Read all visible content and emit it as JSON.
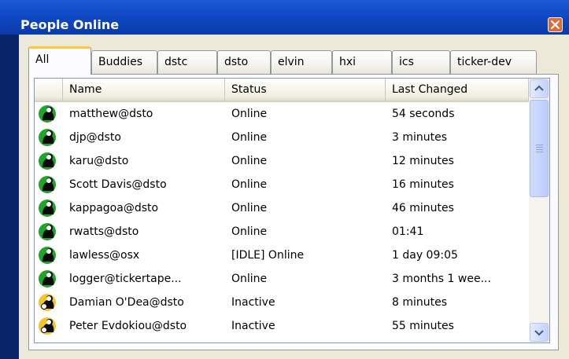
{
  "window": {
    "title": "People Online",
    "colors": {
      "titlebar": "#0e46c0",
      "close": "#e4663a",
      "active_tab_accent": "#ffc83c"
    }
  },
  "tabs": [
    {
      "label": "All",
      "active": true
    },
    {
      "label": "Buddies",
      "active": false
    },
    {
      "label": "dstc",
      "active": false
    },
    {
      "label": "dsto",
      "active": false
    },
    {
      "label": "elvin",
      "active": false
    },
    {
      "label": "hxi",
      "active": false
    },
    {
      "label": "ics",
      "active": false
    },
    {
      "label": "ticker-dev",
      "active": false
    }
  ],
  "table": {
    "columns": [
      "Name",
      "Status",
      "Last Changed"
    ],
    "rows": [
      {
        "name": "matthew@dsto",
        "status": "Online",
        "changed": "54 seconds",
        "icon": "online-person-icon"
      },
      {
        "name": "djp@dsto",
        "status": "Online",
        "changed": "3 minutes",
        "icon": "online-person-icon"
      },
      {
        "name": "karu@dsto",
        "status": "Online",
        "changed": "12 minutes",
        "icon": "online-person-icon"
      },
      {
        "name": "Scott Davis@dsto",
        "status": "Online",
        "changed": "16 minutes",
        "icon": "online-person-icon"
      },
      {
        "name": "kappagoa@dsto",
        "status": "Online",
        "changed": "46 minutes",
        "icon": "online-person-icon"
      },
      {
        "name": "rwatts@dsto",
        "status": "Online",
        "changed": "01:41",
        "icon": "online-person-icon"
      },
      {
        "name": "lawless@osx",
        "status": "[IDLE] Online",
        "changed": "1 day 09:05",
        "icon": "online-person-icon"
      },
      {
        "name": "logger@tickertape...",
        "status": "Online",
        "changed": "3 months 1 wee...",
        "icon": "online-person-icon"
      },
      {
        "name": "Damian O'Dea@dsto",
        "status": "Inactive",
        "changed": "8 minutes",
        "icon": "inactive-person-icon"
      },
      {
        "name": "Peter Evdokiou@dsto",
        "status": "Inactive",
        "changed": "55 minutes",
        "icon": "inactive-person-icon"
      }
    ]
  }
}
